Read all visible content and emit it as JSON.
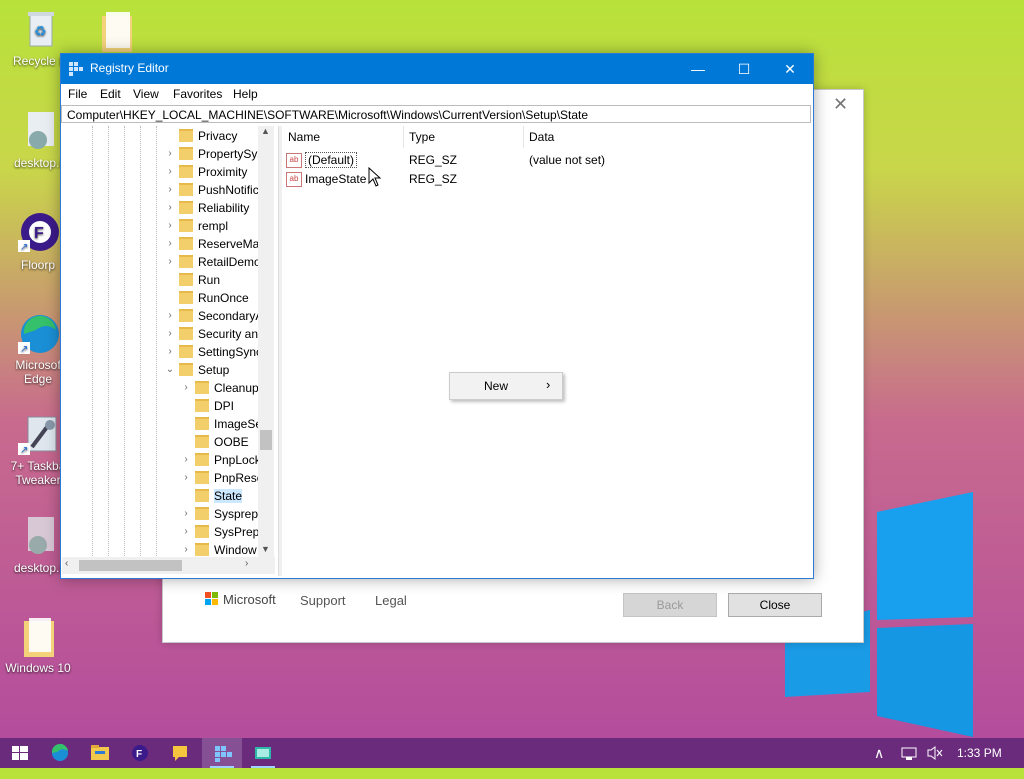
{
  "desktop": {
    "icons": [
      {
        "label": "Recycle B",
        "icon": "recycle-bin-icon"
      },
      {
        "label": "desktop.i",
        "icon": "settings-file-icon"
      },
      {
        "label": "Floorp",
        "icon": "floorp-icon"
      },
      {
        "label": "Microsof Edge",
        "icon": "edge-icon"
      },
      {
        "label": "7+ Taskba Tweaker",
        "icon": "tweaker-icon"
      },
      {
        "label": "desktop.i",
        "icon": "settings-file-icon"
      },
      {
        "label": "Windows 10",
        "icon": "folder-icon"
      }
    ]
  },
  "background_dialog": {
    "brand": "Microsoft",
    "support_link": "Support",
    "legal_link": "Legal",
    "back_button": "Back",
    "close_button": "Close"
  },
  "registry_editor": {
    "title": "Registry Editor",
    "menu": [
      "File",
      "Edit",
      "View",
      "Favorites",
      "Help"
    ],
    "address": "Computer\\HKEY_LOCAL_MACHINE\\SOFTWARE\\Microsoft\\Windows\\CurrentVersion\\Setup\\State",
    "tree": [
      {
        "label": "Privacy",
        "expander": ""
      },
      {
        "label": "PropertySys",
        "expander": ">"
      },
      {
        "label": "Proximity",
        "expander": ">"
      },
      {
        "label": "PushNotific",
        "expander": ">"
      },
      {
        "label": "Reliability",
        "expander": ">"
      },
      {
        "label": "rempl",
        "expander": ">"
      },
      {
        "label": "ReserveMar",
        "expander": ">"
      },
      {
        "label": "RetailDemo",
        "expander": ">"
      },
      {
        "label": "Run",
        "expander": ""
      },
      {
        "label": "RunOnce",
        "expander": ""
      },
      {
        "label": "SecondaryA",
        "expander": ">"
      },
      {
        "label": "Security an",
        "expander": ">"
      },
      {
        "label": "SettingSync",
        "expander": ">"
      },
      {
        "label": "Setup",
        "expander": "v"
      },
      {
        "label": "Cleanup",
        "expander": ">"
      },
      {
        "label": "DPI",
        "expander": ""
      },
      {
        "label": "ImageSe",
        "expander": ""
      },
      {
        "label": "OOBE",
        "expander": ""
      },
      {
        "label": "PnpLock",
        "expander": ">"
      },
      {
        "label": "PnpResc",
        "expander": ">"
      },
      {
        "label": "State",
        "expander": ""
      },
      {
        "label": "Sysprep",
        "expander": ">"
      },
      {
        "label": "SysPrepl",
        "expander": ">"
      },
      {
        "label": "Window",
        "expander": ">"
      }
    ],
    "columns": [
      "Name",
      "Type",
      "Data"
    ],
    "values": [
      {
        "name": "(Default)",
        "type": "REG_SZ",
        "data": "(value not set)"
      },
      {
        "name": "ImageState",
        "type": "REG_SZ",
        "data": ""
      }
    ],
    "context_menu": {
      "item": "New",
      "arrow": "›"
    }
  },
  "taskbar": {
    "apps": [
      "start-icon",
      "edge-icon",
      "file-explorer-icon",
      "floorp-icon",
      "feedback-icon",
      "registry-editor-icon",
      "app-icon"
    ],
    "time": "1:33 PM"
  },
  "colors": {
    "accent": "#0078d7",
    "taskbar": "#6b2b7d"
  }
}
